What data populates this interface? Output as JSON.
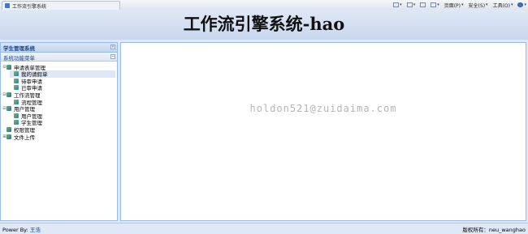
{
  "browser": {
    "tab_title": "工作流引擎系统",
    "toolbar": {
      "page_menu": "页面(P)",
      "safety_menu": "安全(S)",
      "tools_menu": "工具(O)"
    }
  },
  "header": {
    "title": "工作流引擎系统-hao"
  },
  "west": {
    "title": "学生管理系统",
    "collapse_glyph": "«",
    "section_title": "系统功能菜单",
    "section_glyph": "−",
    "tree": [
      {
        "label": "申请表单管理",
        "level": 0,
        "toggle": "⊟"
      },
      {
        "label": "我的请假单",
        "level": 1,
        "selected": true
      },
      {
        "label": "待审申请",
        "level": 1
      },
      {
        "label": "已审申请",
        "level": 1
      },
      {
        "label": "工作流管理",
        "level": 0,
        "toggle": "⊟"
      },
      {
        "label": "流程管理",
        "level": 1
      },
      {
        "label": "用户管理",
        "level": 0,
        "toggle": "⊟"
      },
      {
        "label": "用户管理",
        "level": 1
      },
      {
        "label": "学生管理",
        "level": 1
      },
      {
        "label": "权限管理",
        "level": 0
      },
      {
        "label": "文件上传",
        "level": 0,
        "toggle": "⊞"
      }
    ]
  },
  "center": {
    "watermark": "holdon521@zuidaima.com"
  },
  "footer": {
    "power_label": "Power By:",
    "power_name": "王浩",
    "copyright": "版权所有：neu_wanghao"
  }
}
